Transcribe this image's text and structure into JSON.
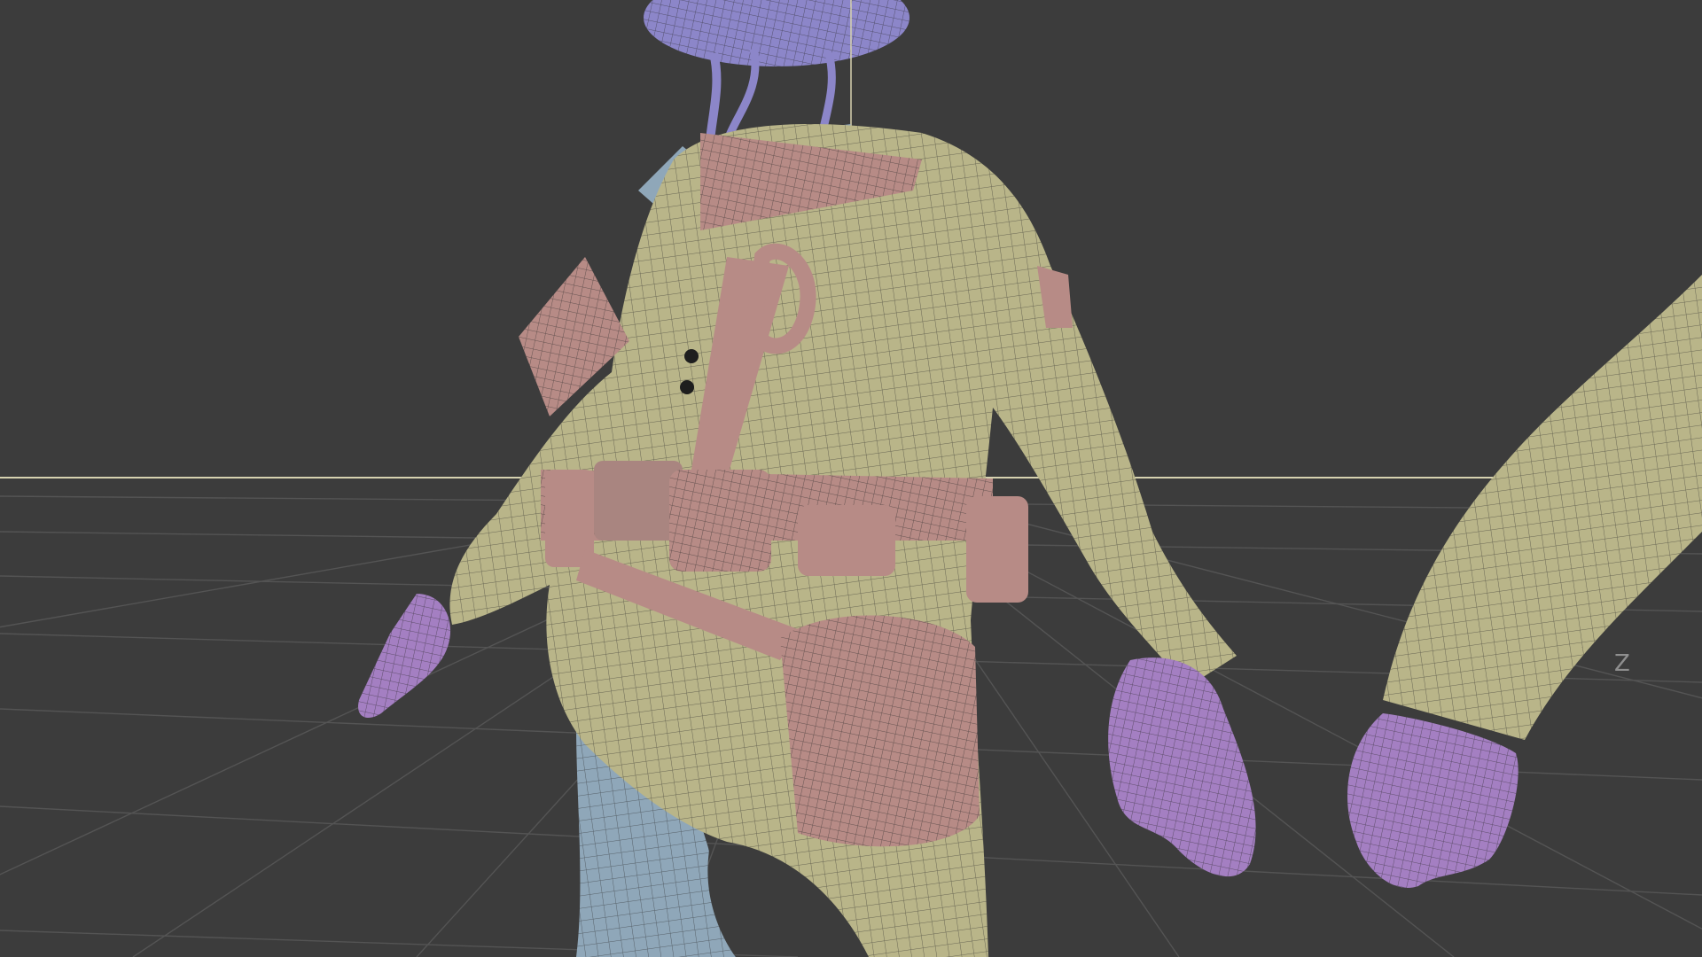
{
  "viewport": {
    "type": "3d-wireframe-viewport",
    "background_color": "#3c3c3c",
    "grid_color": "#525252",
    "horizon_color": "#d6d2b0",
    "axis_label": "Z"
  },
  "model": {
    "parts": [
      {
        "name": "helmet",
        "color": "#8c86c9"
      },
      {
        "name": "jacket",
        "color": "#b9b589"
      },
      {
        "name": "straps-and-pouches",
        "color": "#b78b86"
      },
      {
        "name": "undershirt-and-trousers",
        "color": "#8fa7b9"
      },
      {
        "name": "hands",
        "color": "#a47fc2"
      }
    ],
    "wire_color": "#2f2f2f"
  }
}
